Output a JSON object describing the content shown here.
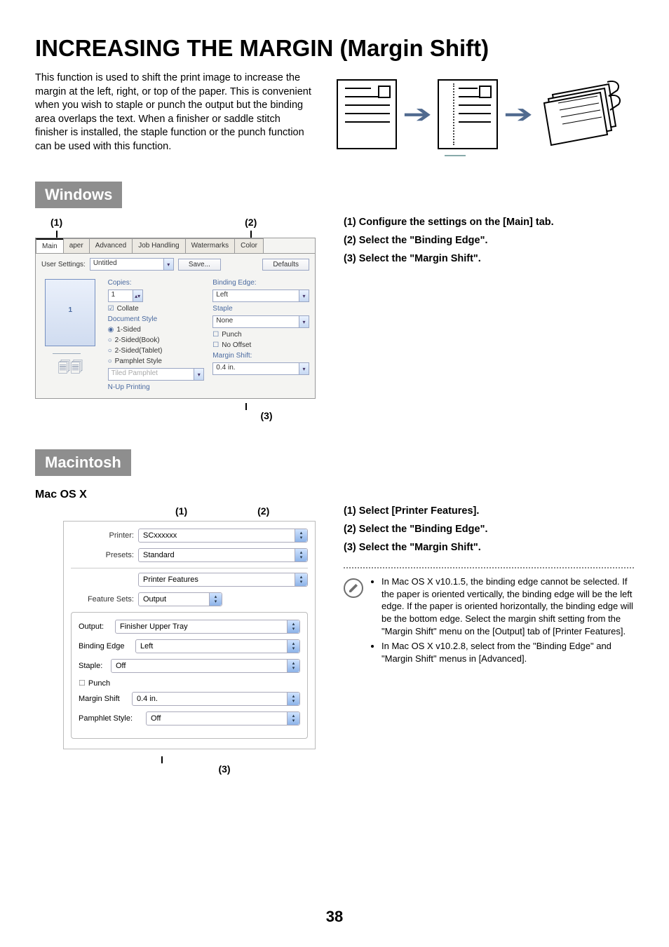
{
  "title": "INCREASING THE MARGIN (Margin Shift)",
  "intro": "This function is used to shift the print image to increase the margin at the left, right, or top of the paper. This is convenient when you wish to staple or punch the output but the binding area overlaps the text. When a finisher or saddle stitch finisher is installed, the staple function or the punch function can be used with this function.",
  "section_windows": "Windows",
  "section_mac": "Macintosh",
  "macx_label": "Mac OS X",
  "callouts": {
    "c1": "(1)",
    "c2": "(2)",
    "c3": "(3)"
  },
  "windows_panel": {
    "tabs": [
      "Main",
      "aper",
      "Advanced",
      "Job Handling",
      "Watermarks",
      "Color"
    ],
    "user_settings_label": "User Settings:",
    "user_settings_value": "Untitled",
    "save_btn": "Save...",
    "defaults_btn": "Defaults",
    "copies_label": "Copies:",
    "copies_value": "1",
    "collate": "Collate",
    "doc_style": "Document Style",
    "r1": "1-Sided",
    "r2": "2-Sided(Book)",
    "r3": "2-Sided(Tablet)",
    "r4": "Pamphlet Style",
    "tiled": "Tiled Pamphlet",
    "nup": "N-Up Printing",
    "binding_label": "Binding Edge:",
    "binding_value": "Left",
    "staple_label": "Staple",
    "staple_value": "None",
    "punch": "Punch",
    "no_offset": "No Offset",
    "margin_label": "Margin Shift:",
    "margin_value": "0.4 in.",
    "preview_num": "1"
  },
  "windows_steps": {
    "s1": "(1)  Configure the settings on the [Main] tab.",
    "s2": "(2)  Select the \"Binding Edge\".",
    "s3": "(3)  Select the \"Margin Shift\"."
  },
  "mac_panel": {
    "printer_label": "Printer:",
    "printer_value": "SCxxxxxx",
    "presets_label": "Presets:",
    "presets_value": "Standard",
    "printer_features": "Printer Features",
    "feature_sets_label": "Feature Sets:",
    "feature_sets_value": "Output",
    "output_label": "Output:",
    "output_value": "Finisher Upper Tray",
    "binding_label": "Binding Edge",
    "binding_value": "Left",
    "staple_label": "Staple:",
    "staple_value": "Off",
    "punch": "Punch",
    "margin_label": "Margin Shift",
    "margin_value": "0.4 in.",
    "pamphlet_label": "Pamphlet Style:",
    "pamphlet_value": "Off"
  },
  "mac_steps": {
    "s1": "(1)  Select [Printer Features].",
    "s2": "(2)  Select the \"Binding Edge\".",
    "s3": "(3)  Select the \"Margin Shift\"."
  },
  "notes": {
    "n1": "In Mac OS X v10.1.5, the binding edge cannot be selected. If the paper is oriented vertically, the binding edge will be the left edge. If the paper is oriented horizontally, the binding edge will be the bottom edge. Select the margin shift setting from the \"Margin Shift\" menu on the [Output] tab of [Printer Features].",
    "n2": "In Mac OS X v10.2.8, select from the \"Binding Edge\" and \"Margin Shift\" menus in [Advanced]."
  },
  "page_number": "38"
}
